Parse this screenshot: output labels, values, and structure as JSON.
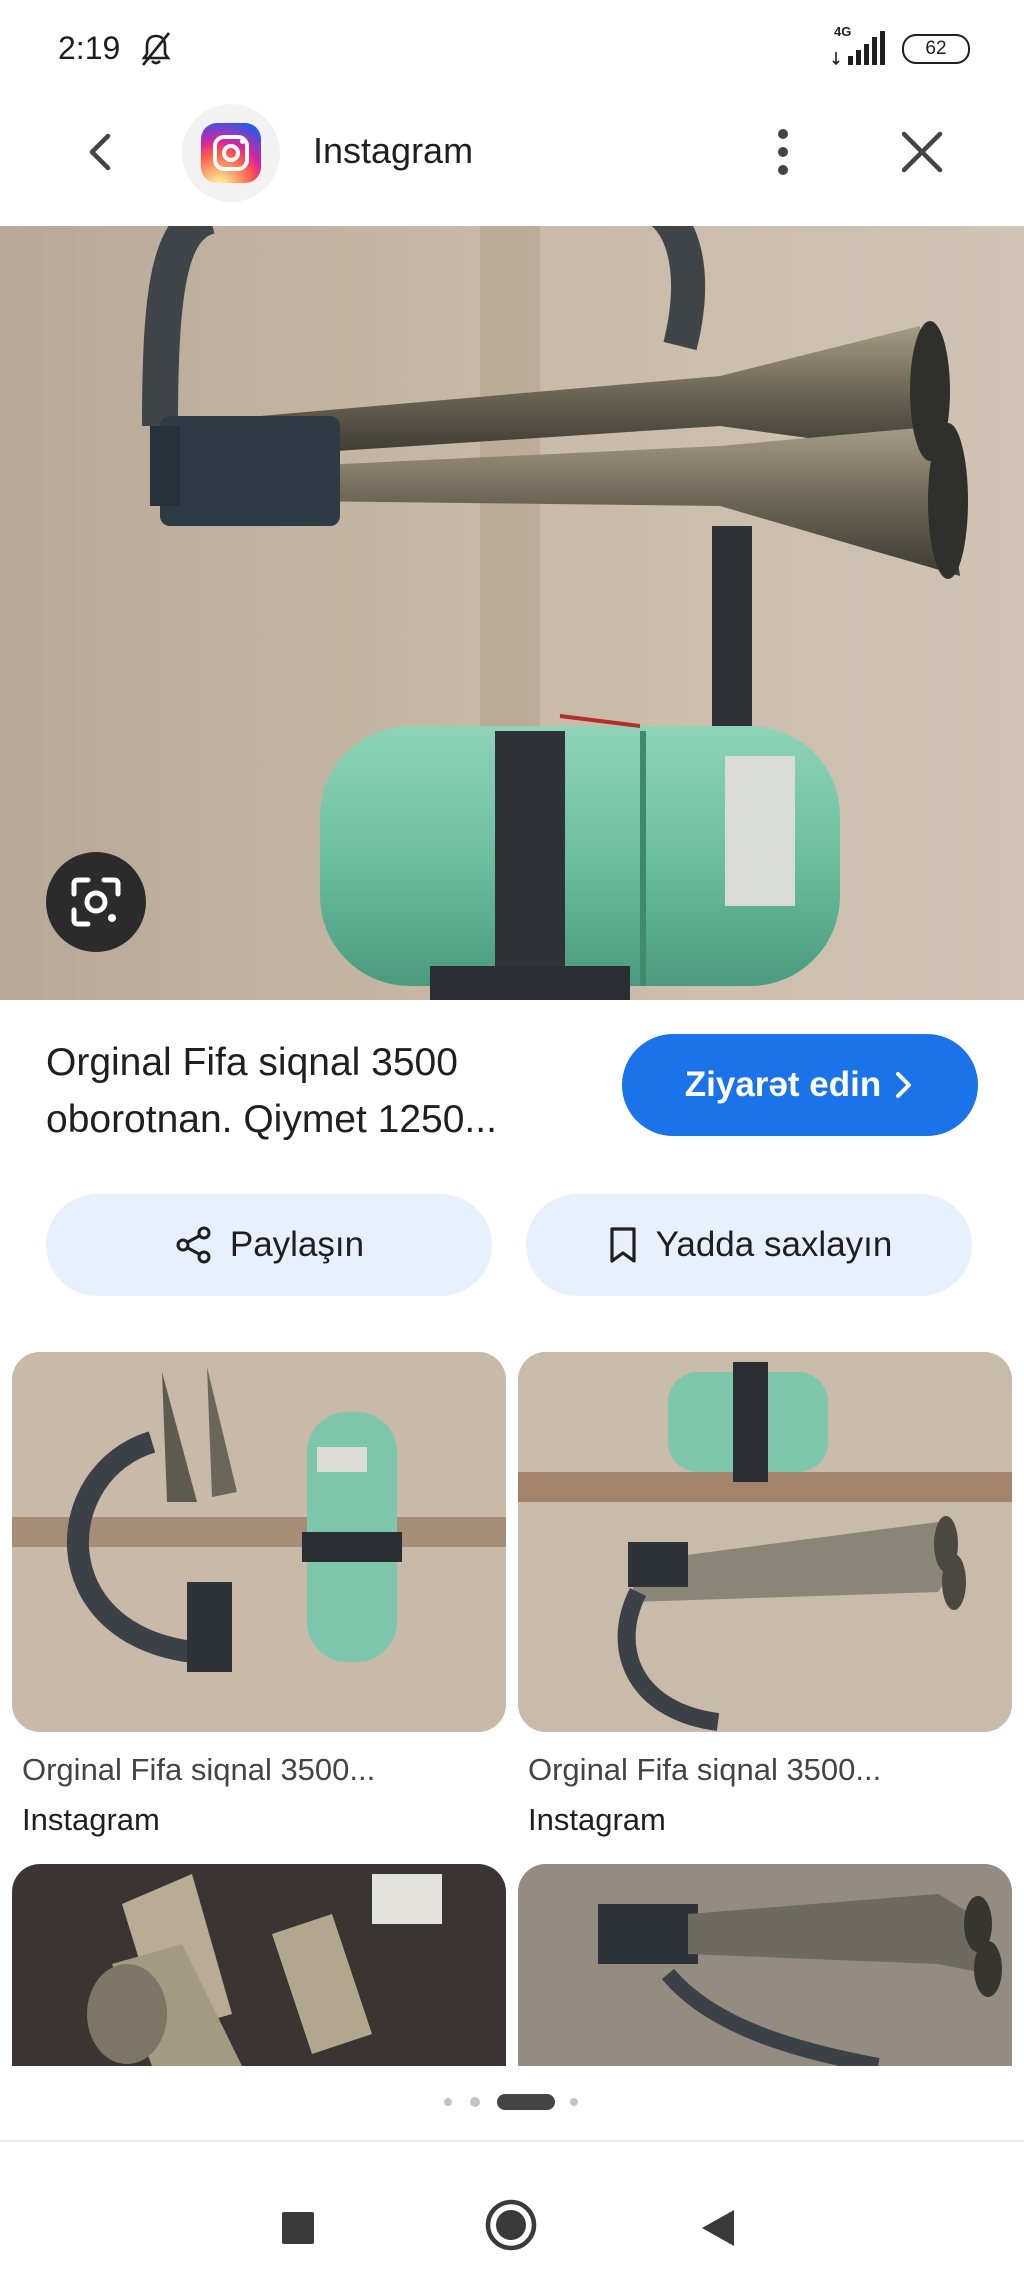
{
  "status_bar": {
    "time": "2:19",
    "network": "4G",
    "battery": "62"
  },
  "header": {
    "app_name": "Instagram",
    "back_icon": "chevron-left-icon",
    "menu_icon": "more-vert-icon",
    "close_icon": "close-icon"
  },
  "main": {
    "title": "Orginal Fifa siqnal 3500 oborotnan. Qiymet 1250...",
    "visit_label": "Ziyarət edin",
    "share_label": "Paylaşın",
    "save_label": "Yadda saxlayın",
    "accent_color": "#1a73e8"
  },
  "related": [
    {
      "title": "Orginal Fifa siqnal 3500...",
      "source": "Instagram"
    },
    {
      "title": "Orginal Fifa siqnal 3500...",
      "source": "Instagram"
    }
  ],
  "pager": {
    "pages": 4,
    "current": 3
  }
}
